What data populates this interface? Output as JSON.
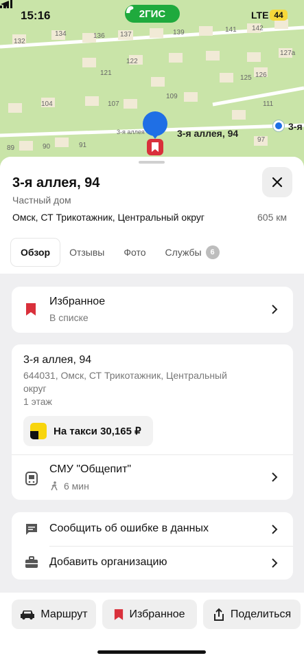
{
  "status_bar": {
    "time": "15:16",
    "network": "LTE",
    "battery": "44"
  },
  "brand": {
    "name": "2ГИС"
  },
  "map": {
    "house_numbers": [
      "132",
      "134",
      "136",
      "137",
      "139",
      "141",
      "142",
      "127а",
      "122",
      "121",
      "125",
      "126",
      "109",
      "104",
      "107",
      "111",
      "89",
      "90",
      "91",
      "97"
    ],
    "street_label": "3-я аллея, 94",
    "street_label_cut": "3-я",
    "street_label_small": "3-я аллея"
  },
  "place": {
    "title": "3-я аллея, 94",
    "subtitle": "Частный дом",
    "address": "Омск, СТ Трикотажник, Центральный округ",
    "distance": "605 км"
  },
  "tabs": [
    {
      "label": "Обзор",
      "active": true
    },
    {
      "label": "Отзывы"
    },
    {
      "label": "Фото"
    },
    {
      "label": "Службы",
      "badge": "6"
    }
  ],
  "favorite": {
    "title": "Избранное",
    "status": "В списке",
    "icon": "bookmark-icon"
  },
  "info": {
    "title": "3-я аллея, 94",
    "full_address_line1": "644031, Омск, СТ Трикотажник, Центральный",
    "full_address_line2": "округ",
    "floor": "1 этаж",
    "taxi_label": "На такси 30,165 ₽",
    "stop_name": "СМУ \"Общепит\"",
    "walk_time": "6 мин"
  },
  "actions": [
    {
      "label": "Сообщить об ошибке в данных",
      "icon": "comment-icon"
    },
    {
      "label": "Добавить организацию",
      "icon": "briefcase-icon"
    }
  ],
  "bottom_buttons": [
    {
      "label": "Маршрут",
      "icon": "car-icon"
    },
    {
      "label": "Избранное",
      "icon": "bookmark-icon"
    },
    {
      "label": "Поделиться",
      "icon": "share-icon"
    }
  ],
  "colors": {
    "accent_green": "#1faa3d",
    "pin_blue": "#1f6fe5",
    "bookmark_red": "#d9303b"
  }
}
